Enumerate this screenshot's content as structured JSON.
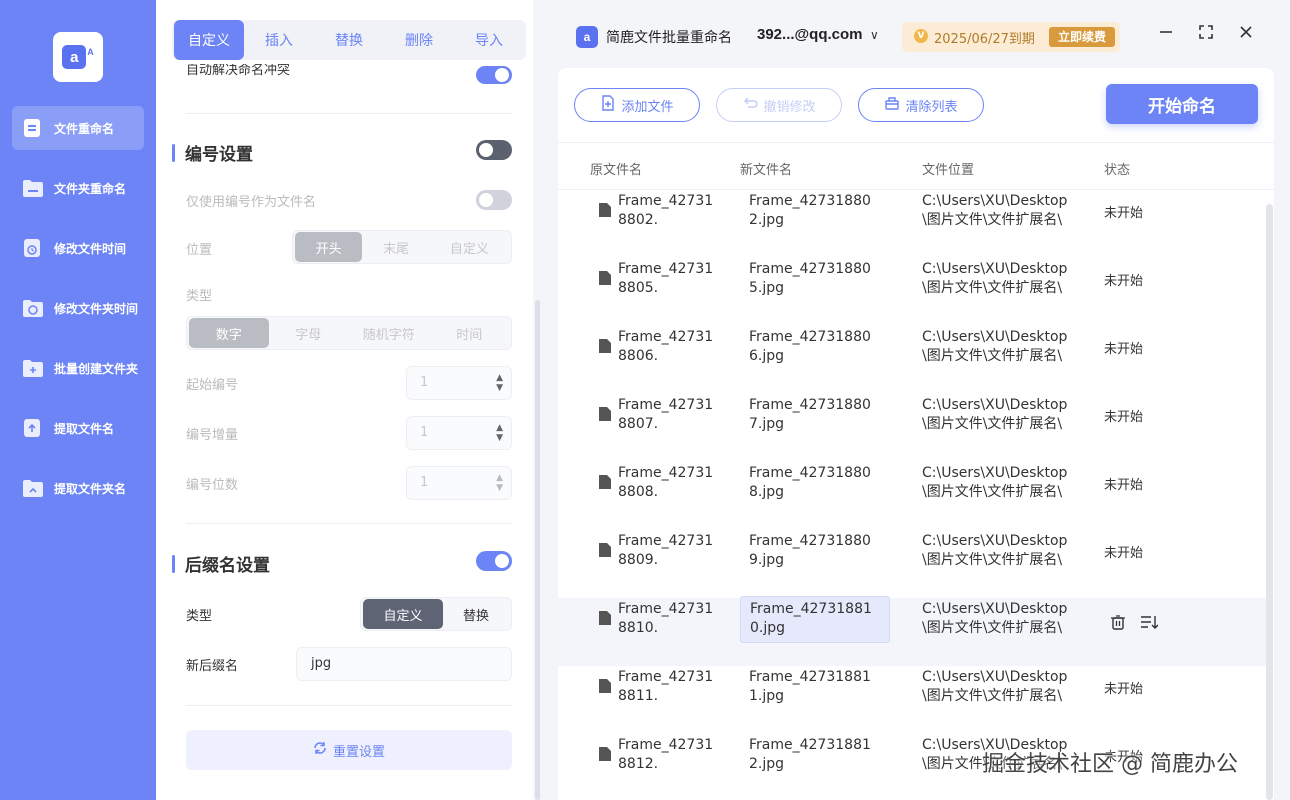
{
  "sidebar": {
    "logo_letters": "a",
    "logo_small": "A",
    "items": [
      {
        "label": "文件重命名"
      },
      {
        "label": "文件夹重命名"
      },
      {
        "label": "修改文件时间"
      },
      {
        "label": "修改文件夹时间"
      },
      {
        "label": "批量创建文件夹"
      },
      {
        "label": "提取文件名"
      },
      {
        "label": "提取文件夹名"
      }
    ]
  },
  "settings": {
    "tabs": [
      "自定义",
      "插入",
      "替换",
      "删除",
      "导入"
    ],
    "partial_option_label": "自动解决命名冲突",
    "numbering": {
      "title": "编号设置",
      "only_number_label": "仅使用编号作为文件名",
      "position_label": "位置",
      "position_options": [
        "开头",
        "末尾",
        "自定义"
      ],
      "type_label": "类型",
      "type_options": [
        "数字",
        "字母",
        "随机字符",
        "时间"
      ],
      "start_label": "起始编号",
      "start_value": "1",
      "increment_label": "编号增量",
      "increment_value": "1",
      "digits_label": "编号位数",
      "digits_value": "1"
    },
    "suffix": {
      "title": "后缀名设置",
      "type_label": "类型",
      "type_options": [
        "自定义",
        "替换"
      ],
      "new_suffix_label": "新后缀名",
      "new_suffix_value": "jpg"
    },
    "reset_label": "重置设置"
  },
  "topbar": {
    "app_logo": "a",
    "app_name": "简鹿文件批量重命名",
    "user": "392...@qq.com",
    "vip_icon": "V",
    "expiry": "2025/06/27到期",
    "renew_label": "立即续费"
  },
  "toolbar": {
    "add_files": "添加文件",
    "undo": "撤销修改",
    "clear": "清除列表",
    "start": "开始命名"
  },
  "table": {
    "headers": [
      "原文件名",
      "新文件名",
      "文件位置",
      "状态"
    ],
    "rows": [
      {
        "orig": "Frame_427318802.",
        "new": "Frame_427318802.jpg",
        "loc": "C:\\Users\\XU\\Desktop\\图片文件\\文件扩展名\\",
        "status": "未开始"
      },
      {
        "orig": "Frame_427318805.",
        "new": "Frame_427318805.jpg",
        "loc": "C:\\Users\\XU\\Desktop\\图片文件\\文件扩展名\\",
        "status": "未开始"
      },
      {
        "orig": "Frame_427318806.",
        "new": "Frame_427318806.jpg",
        "loc": "C:\\Users\\XU\\Desktop\\图片文件\\文件扩展名\\",
        "status": "未开始"
      },
      {
        "orig": "Frame_427318807.",
        "new": "Frame_427318807.jpg",
        "loc": "C:\\Users\\XU\\Desktop\\图片文件\\文件扩展名\\",
        "status": "未开始"
      },
      {
        "orig": "Frame_427318808.",
        "new": "Frame_427318808.jpg",
        "loc": "C:\\Users\\XU\\Desktop\\图片文件\\文件扩展名\\",
        "status": "未开始"
      },
      {
        "orig": "Frame_427318809.",
        "new": "Frame_427318809.jpg",
        "loc": "C:\\Users\\XU\\Desktop\\图片文件\\文件扩展名\\",
        "status": "未开始"
      },
      {
        "orig": "Frame_427318810.",
        "new": "Frame_427318810.jpg",
        "loc": "C:\\Users\\XU\\Desktop\\图片文件\\文件扩展名\\",
        "status": ""
      },
      {
        "orig": "Frame_427318811.",
        "new": "Frame_427318811.jpg",
        "loc": "C:\\Users\\XU\\Desktop\\图片文件\\文件扩展名\\",
        "status": "未开始"
      },
      {
        "orig": "Frame_427318812.",
        "new": "Frame_427318812.jpg",
        "loc": "C:\\Users\\XU\\Desktop\\图片文件\\文件扩展名\\",
        "status": "未开始"
      }
    ]
  },
  "watermark": "掘金技术社区 @ 简鹿办公",
  "colors": {
    "accent": "#6c84f5",
    "sidebar": "#6c84f5",
    "vip_bg": "#fdecd5",
    "vip_btn": "#d99a3d"
  }
}
